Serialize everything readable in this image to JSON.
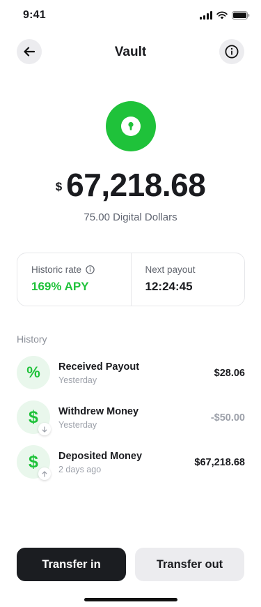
{
  "status_bar": {
    "time": "9:41"
  },
  "header": {
    "title": "Vault"
  },
  "balance": {
    "currency_symbol": "$",
    "amount": "67,218.68",
    "sub": "75.00 Digital Dollars"
  },
  "info_card": {
    "rate_label": "Historic rate",
    "rate_value": "169% APY",
    "payout_label": "Next payout",
    "payout_value": "12:24:45"
  },
  "history": {
    "heading": "History",
    "items": [
      {
        "icon": "percent-icon",
        "glyph": "%",
        "title": "Received Payout",
        "subtitle": "Yesterday",
        "amount": "$28.06"
      },
      {
        "icon": "dollar-icon",
        "glyph": "$",
        "badge": "arrow-down-icon",
        "title": "Withdrew Money",
        "subtitle": "Yesterday",
        "amount": "-$50.00"
      },
      {
        "icon": "dollar-icon",
        "glyph": "$",
        "badge": "arrow-up-icon",
        "title": "Deposited Money",
        "subtitle": "2 days ago",
        "amount": "$67,218.68"
      }
    ]
  },
  "actions": {
    "transfer_in": "Transfer in",
    "transfer_out": "Transfer out"
  },
  "colors": {
    "accent_green": "#1fc23a",
    "dark_button": "#1b1d21",
    "light_button": "#ececef",
    "muted_text": "#9da1aa"
  }
}
